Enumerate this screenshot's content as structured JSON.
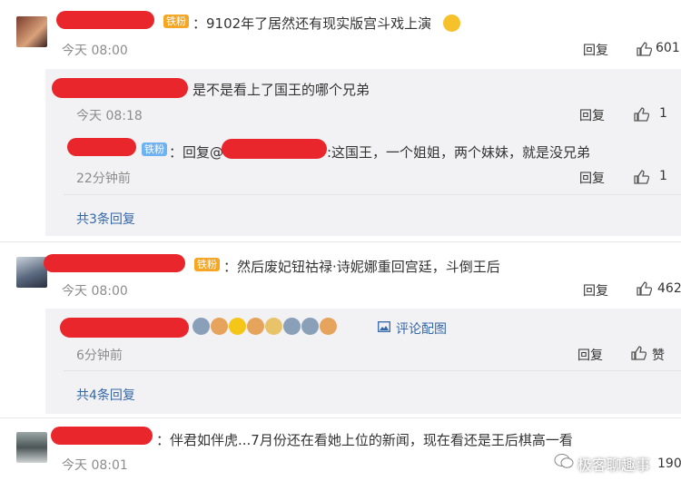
{
  "comments": [
    {
      "badge": "铁粉",
      "text": "：9102年了居然还有现实版宫斗戏上演",
      "time": "今天 08:00",
      "reply_label": "回复",
      "likes": "601",
      "replies": [
        {
          "text": "是不是看上了国王的哪个兄弟",
          "time": "今天 08:18",
          "reply_label": "回复",
          "likes": "1"
        },
        {
          "badge": "铁粉",
          "prefix": "：回复@",
          "text": ":这国王，一个姐姐，两个妹妹，就是没兄弟",
          "time": "22分钟前",
          "reply_label": "回复",
          "likes": "1"
        }
      ],
      "more": "共3条回复"
    },
    {
      "badge": "铁粉",
      "text": "：然后废妃钮祜禄·诗妮娜重回宫廷，斗倒王后",
      "time": "今天 08:00",
      "reply_label": "回复",
      "likes": "462",
      "replies": [
        {
          "pic_link": "评论配图",
          "time": "6分钟前",
          "reply_label": "回复",
          "likes": "赞"
        }
      ],
      "more": "共4条回复"
    },
    {
      "text": "：伴君如伴虎...7月份还在看她上位的新闻，现在看还是王后棋高一看",
      "time": "今天 08:01",
      "likes": "190"
    }
  ],
  "watermark": "极客聊趣事",
  "colors": {
    "link": "#3467a8",
    "redaction": "#e8262b",
    "reply_bg": "#f2f2f5"
  }
}
